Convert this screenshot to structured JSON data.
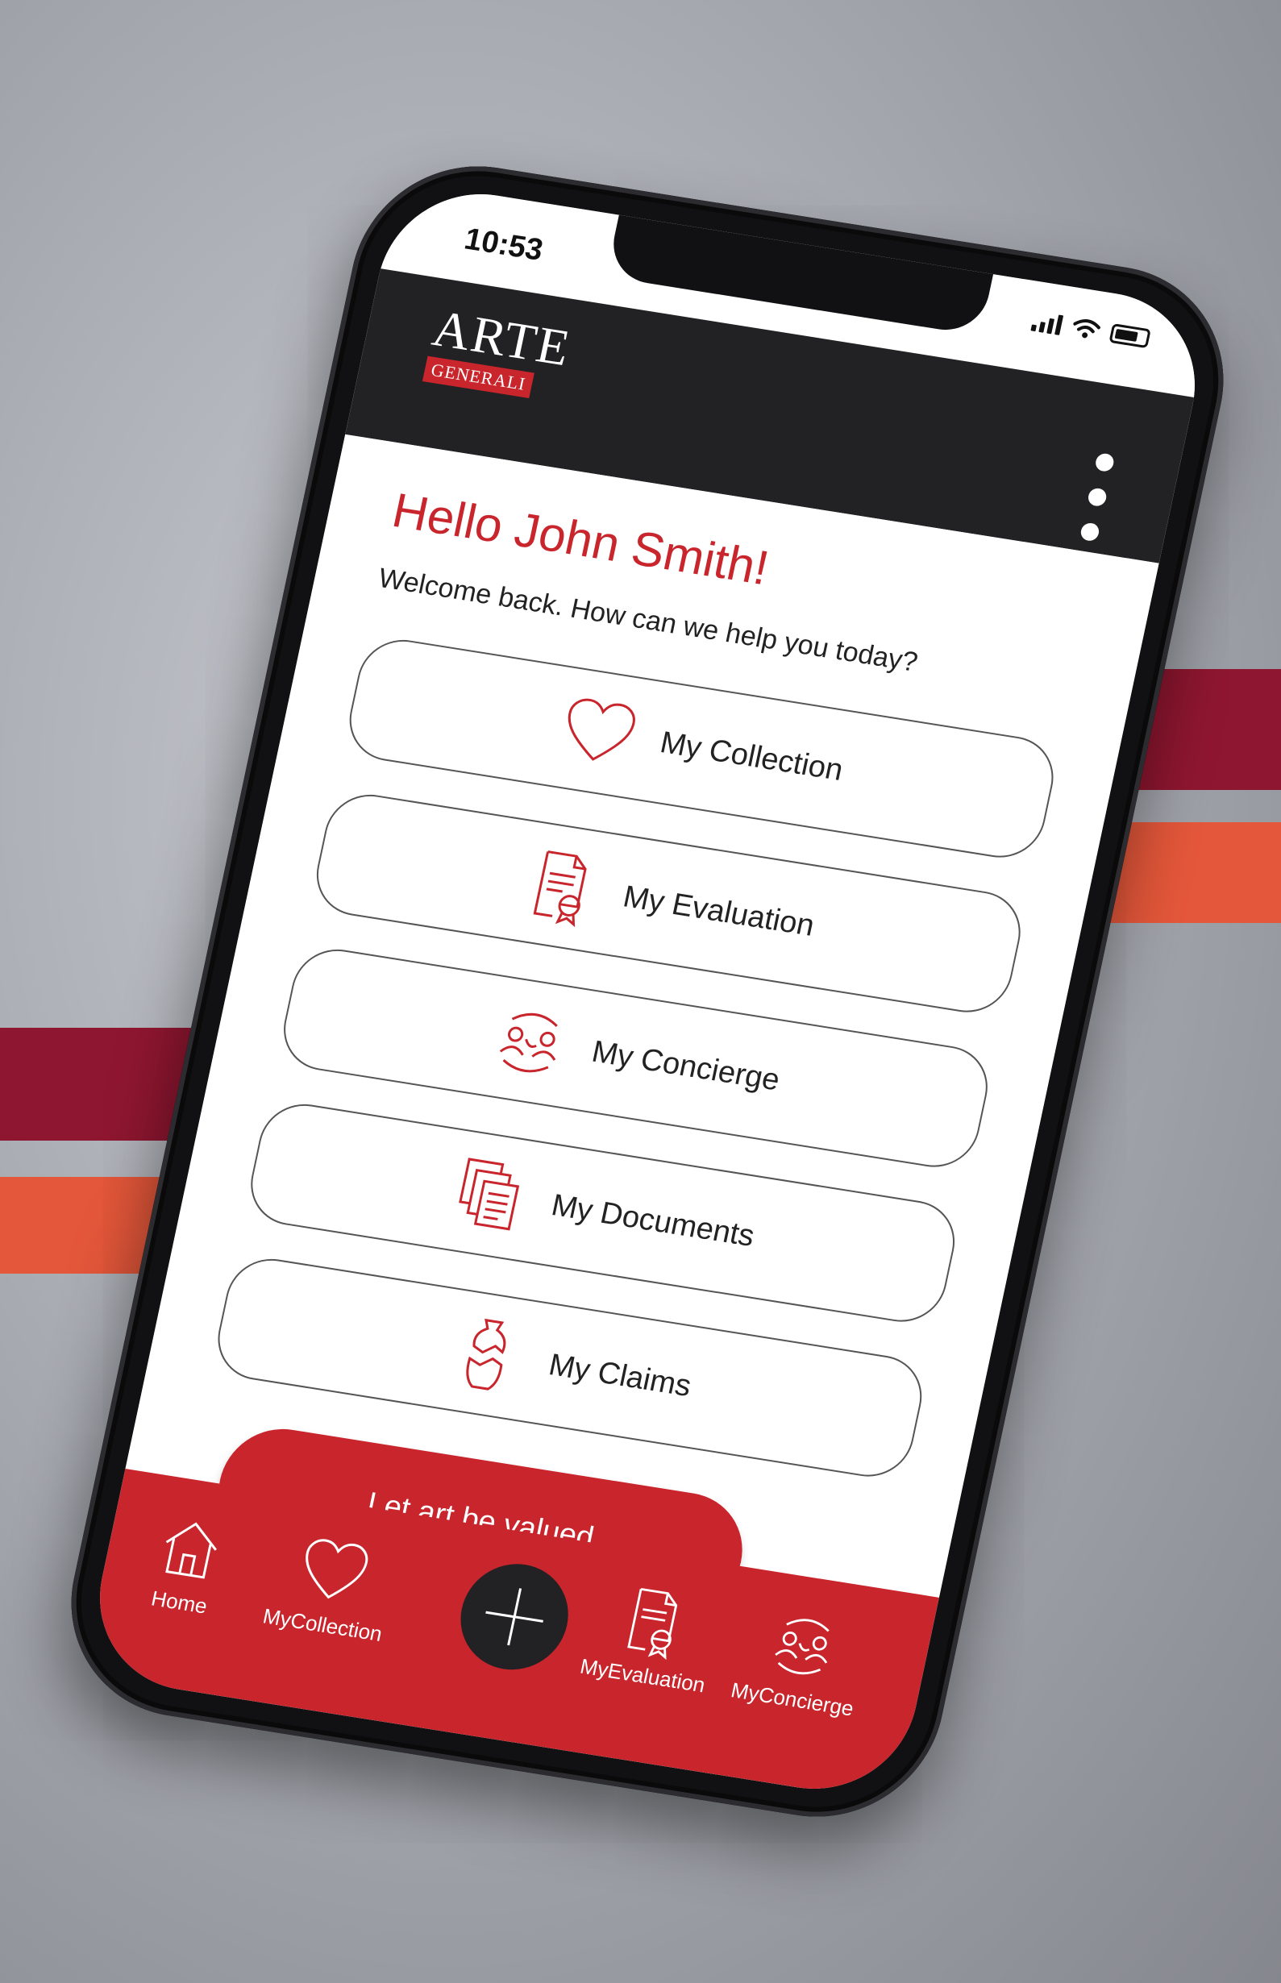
{
  "status_bar": {
    "time": "10:53"
  },
  "header": {
    "logo_main": "ARTE",
    "logo_sub": "GENERALI"
  },
  "home": {
    "greeting": "Hello John Smith!",
    "subtitle": "Welcome back. How can we help you today?",
    "menu": [
      {
        "label": "My Collection",
        "icon": "heart-icon"
      },
      {
        "label": "My Evaluation",
        "icon": "certificate-icon"
      },
      {
        "label": "My Concierge",
        "icon": "concierge-icon"
      },
      {
        "label": "My Documents",
        "icon": "documents-icon"
      },
      {
        "label": "My Claims",
        "icon": "broken-vase-icon"
      }
    ],
    "cta_label": "Let art be valued"
  },
  "tab_bar": {
    "tabs": [
      {
        "label": "Home",
        "icon": "home-icon"
      },
      {
        "label": "MyCollection",
        "icon": "heart-icon"
      },
      {
        "label": "MyEvaluation",
        "icon": "certificate-icon"
      },
      {
        "label": "MyConcierge",
        "icon": "concierge-icon"
      }
    ],
    "fab_icon": "plus-icon"
  },
  "colors": {
    "brand_red": "#c8252c",
    "header_dark": "#222224",
    "stripe_crimson": "#8f1630",
    "stripe_orange": "#e4573a"
  }
}
